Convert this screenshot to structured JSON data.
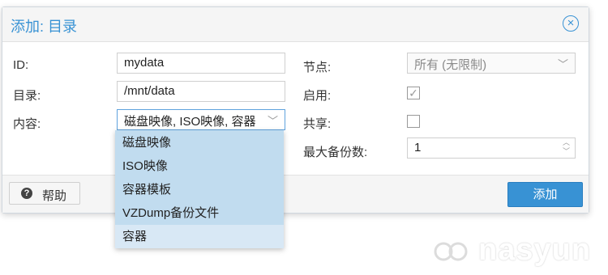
{
  "dialog": {
    "title": "添加: 目录",
    "close_icon": "close-circle-icon"
  },
  "form": {
    "id_label": "ID:",
    "id_value": "mydata",
    "dir_label": "目录:",
    "dir_value": "/mnt/data",
    "content_label": "内容:",
    "content_value": "磁盘映像, ISO映像, 容器",
    "node_label": "节点:",
    "node_value": "所有 (无限制)",
    "enable_label": "启用:",
    "enable_checked": true,
    "shared_label": "共享:",
    "shared_checked": false,
    "max_backups_label": "最大备份数:",
    "max_backups_value": "1"
  },
  "dropdown": {
    "options": [
      "磁盘映像",
      "ISO映像",
      "容器模板",
      "VZDump备份文件",
      "容器"
    ],
    "hovered": "容器"
  },
  "footer": {
    "help_label": "帮助",
    "add_label": "添加"
  },
  "watermark": {
    "text": "nasyun"
  }
}
